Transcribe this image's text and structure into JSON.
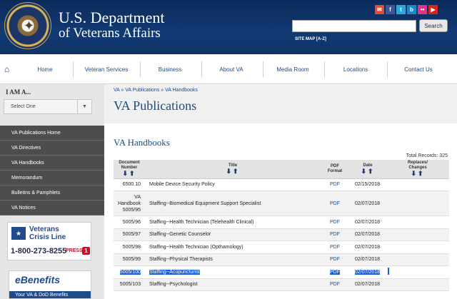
{
  "header": {
    "dept_line1": "U.S. Department",
    "dept_line2": "of Veterans Affairs",
    "search_button": "Search",
    "sitemap": "SITE MAP [A-Z]",
    "social": [
      {
        "icon": "email-icon",
        "glyph": "✉",
        "color": "#e84a2f"
      },
      {
        "icon": "facebook-icon",
        "glyph": "f",
        "color": "#3b5998"
      },
      {
        "icon": "twitter-icon",
        "glyph": "t",
        "color": "#2aa9e0"
      },
      {
        "icon": "blog-icon",
        "glyph": "b",
        "color": "#1e88c7"
      },
      {
        "icon": "flickr-icon",
        "glyph": "••",
        "color": "#e0338f"
      },
      {
        "icon": "youtube-icon",
        "glyph": "▶",
        "color": "#d7261b"
      }
    ]
  },
  "nav": {
    "items": [
      "Home",
      "Veteran Services",
      "Business",
      "About VA",
      "Media Room",
      "Locations",
      "Contact Us"
    ]
  },
  "sidebar": {
    "iam_label": "I AM A...",
    "select_value": "Select One",
    "links": [
      "VA Publications Home",
      "VA Directives",
      "VA Handbooks",
      "Memorandum",
      "Bulletins & Pamphlets",
      "VA Notices"
    ],
    "crisis": {
      "line1": "Veterans",
      "line2": "Crisis Line",
      "phone": "1-800-273-8255",
      "press": "PRESS",
      "one": "1"
    },
    "ebenefits": {
      "logo": "eBenefits",
      "tagline": "Your VA & DoD Benefits"
    }
  },
  "main": {
    "breadcrumb": "VA » VA Publications » VA Handbooks",
    "page_title": "VA Publications",
    "section_title": "VA Handbooks",
    "total_records": "Total Records: 325",
    "columns": {
      "number": [
        "Document",
        "Number"
      ],
      "title": "Title",
      "format": [
        "PDF",
        "Format"
      ],
      "date": "Date",
      "replaces": [
        "Replaces/",
        "Changes"
      ],
      "sort_glyph": "🡇🡅"
    },
    "rows": [
      {
        "number": [
          "6500.10"
        ],
        "title": "Mobile Device Security Policy",
        "format": "PDF",
        "date": "02/15/2018"
      },
      {
        "number": [
          "VA",
          "Handbook",
          "5005/95"
        ],
        "title": "Staffing--Biomedical Equipment Support Specialist",
        "format": "PDF",
        "date": "02/07/2018"
      },
      {
        "number": [
          "5005/96"
        ],
        "title": "Staffing--Health Technician (Telehealth Clinical)",
        "format": "PDF",
        "date": "02/07/2018"
      },
      {
        "number": [
          "5005/97"
        ],
        "title": "Staffing--Genetic Counselor",
        "format": "PDF",
        "date": "02/07/2018"
      },
      {
        "number": [
          "5005/98"
        ],
        "title": "Staffing--Health Technician (Opthamology)",
        "format": "PDF",
        "date": "02/07/2018"
      },
      {
        "number": [
          "5005/99"
        ],
        "title": "Staffing--Physical Therapists",
        "format": "PDF",
        "date": "02/07/2018"
      },
      {
        "number": [
          "5005/100"
        ],
        "title": "Staffing--Acupuncturist",
        "format": "PDF",
        "date": "02/07/2018"
      },
      {
        "number": [
          "5005/103"
        ],
        "title": "Staffing--Psychologist",
        "format": "PDF",
        "date": "02/07/2018"
      }
    ],
    "selected_row": 6
  }
}
